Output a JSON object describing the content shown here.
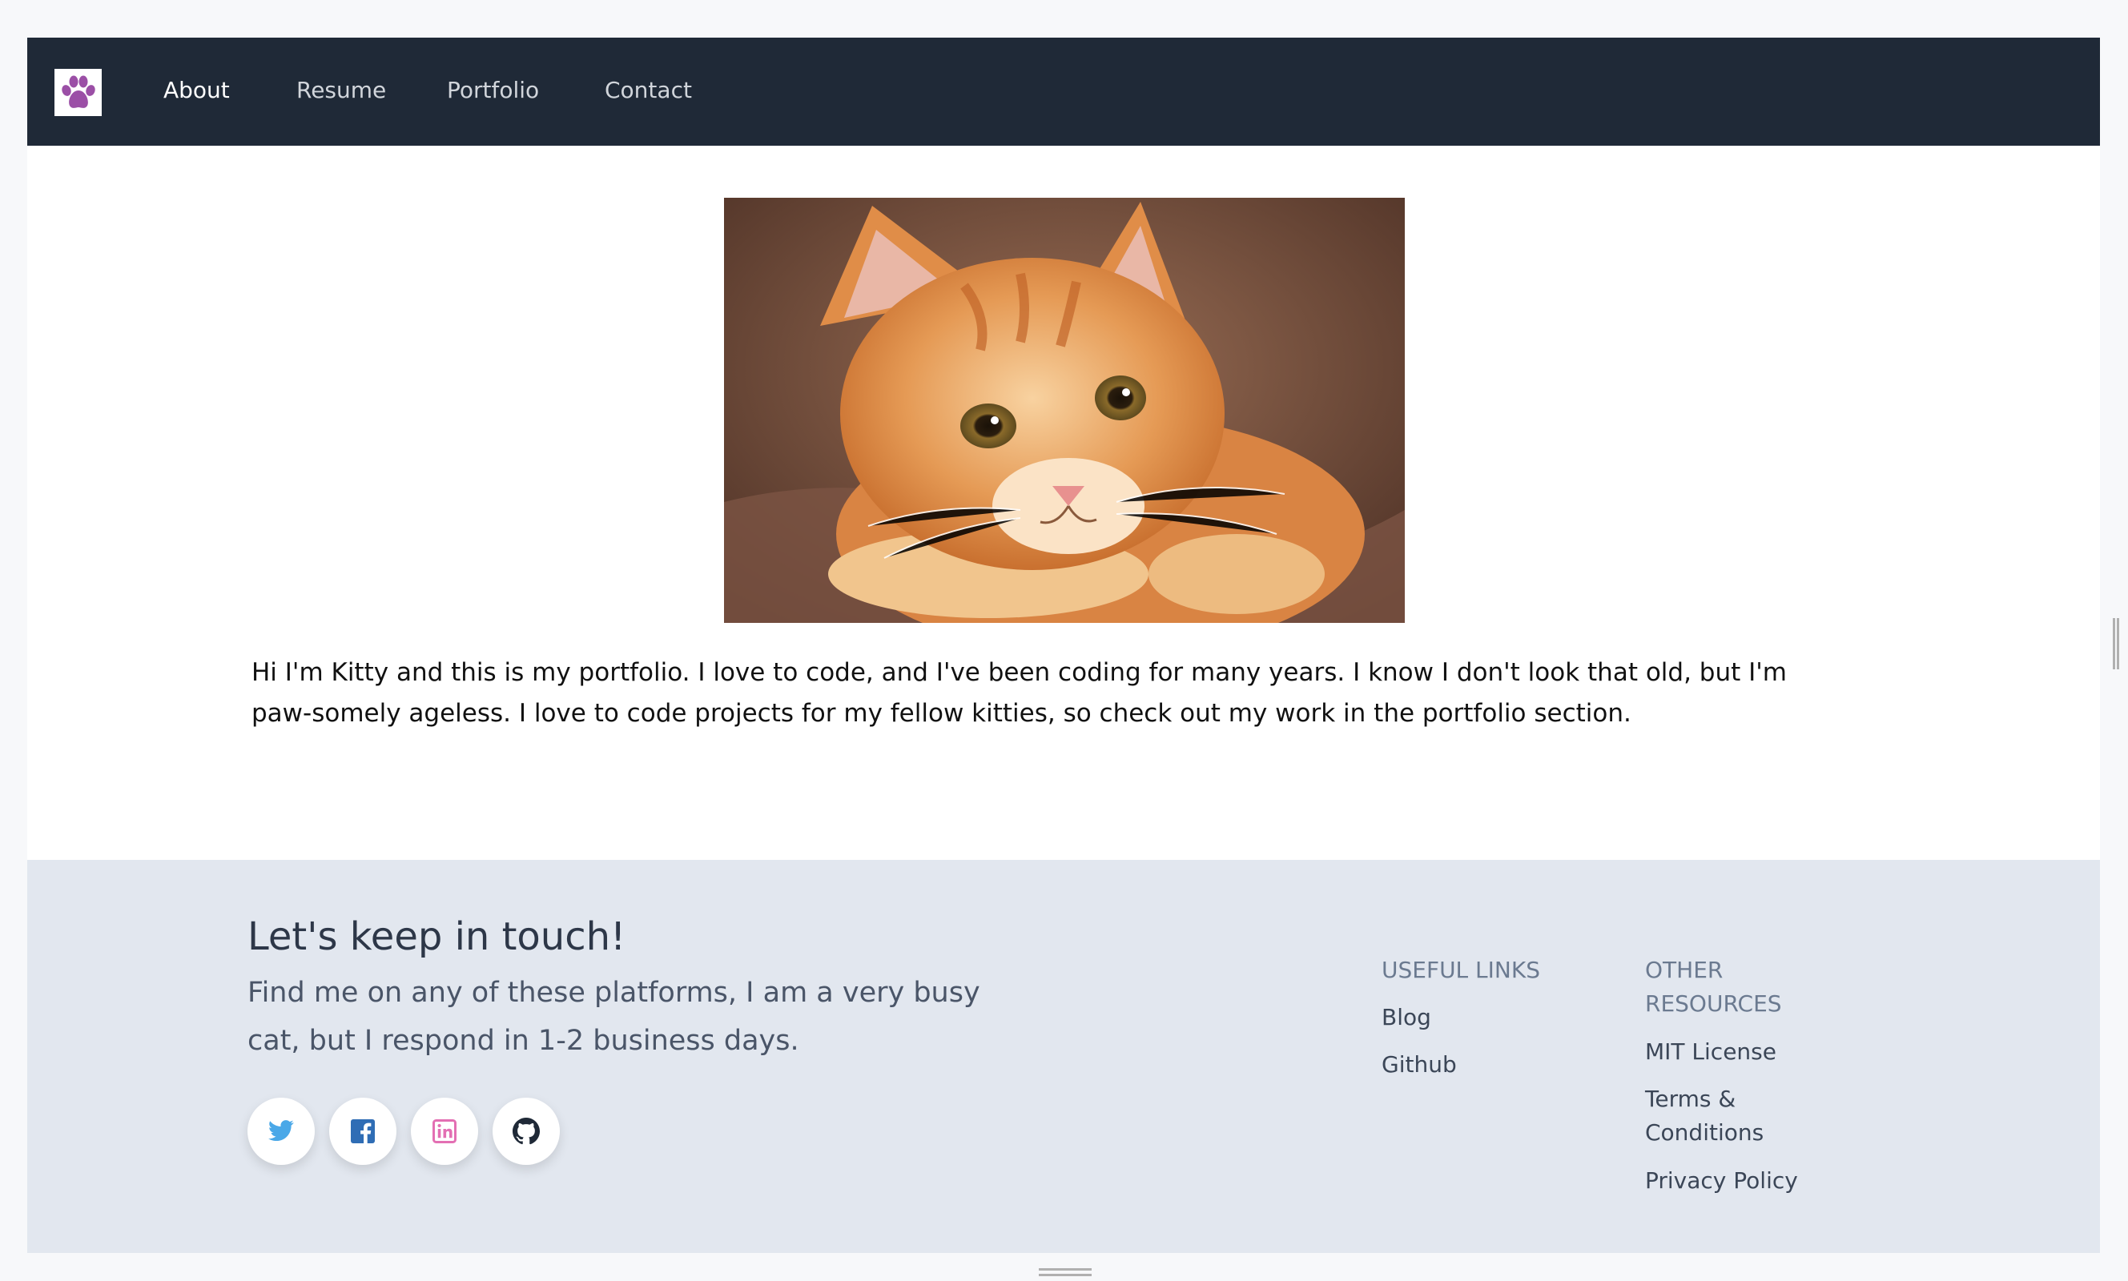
{
  "nav": {
    "items": [
      {
        "label": "About",
        "active": true
      },
      {
        "label": "Resume",
        "active": false
      },
      {
        "label": "Portfolio",
        "active": false
      },
      {
        "label": "Contact",
        "active": false
      }
    ],
    "logo_icon": "paw-icon",
    "logo_color": "#9b4fa6"
  },
  "main": {
    "photo_icon": "kitten-photo",
    "intro": "Hi I'm Kitty and this is my portfolio. I love to code, and I've been coding for many years. I know I don't look that old, but I'm paw-somely ageless. I love to code projects for my fellow kitties, so check out my work in the portfolio section."
  },
  "footer": {
    "title": "Let's keep in touch!",
    "subtitle": "Find me on any of these platforms, I am a very busy cat, but I respond in 1-2 business days.",
    "socials": [
      {
        "icon": "twitter-icon",
        "color": "#4aa8e8"
      },
      {
        "icon": "facebook-icon",
        "color": "#2f6db5"
      },
      {
        "icon": "linkedin-icon",
        "color": "#e36fb3"
      },
      {
        "icon": "github-icon",
        "color": "#1f2937"
      }
    ],
    "useful_links": {
      "heading": "USEFUL LINKS",
      "items": [
        "Blog",
        "Github"
      ]
    },
    "other_resources": {
      "heading": "OTHER RESOURCES",
      "items": [
        "MIT License",
        "Terms & Conditions",
        "Privacy Policy"
      ]
    }
  }
}
